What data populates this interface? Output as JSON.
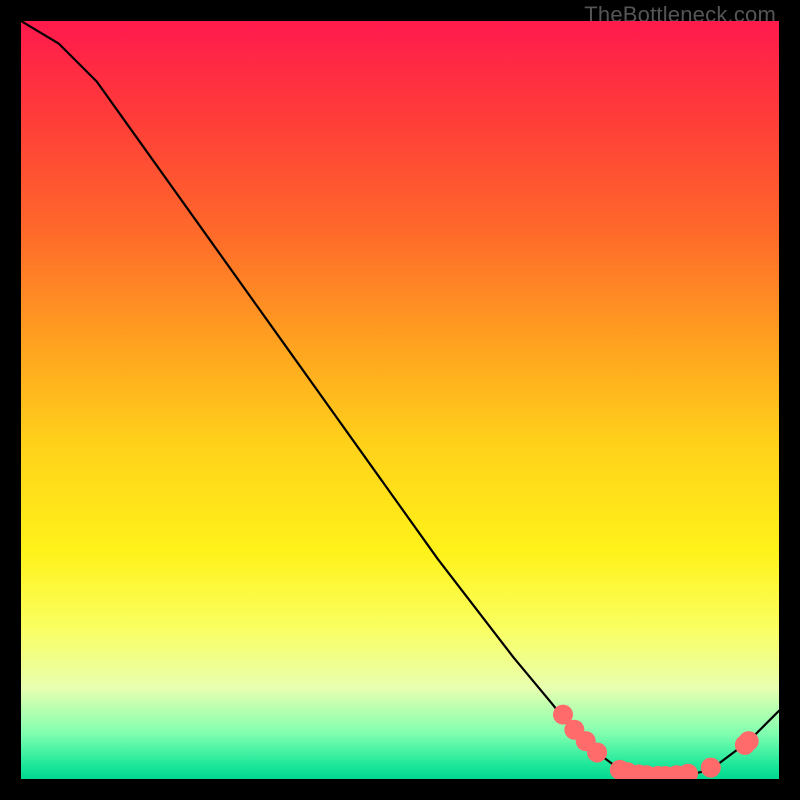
{
  "watermark": "TheBottleneck.com",
  "chart_data": {
    "type": "line",
    "title": "",
    "xlabel": "",
    "ylabel": "",
    "xlim": [
      0,
      100
    ],
    "ylim": [
      0,
      100
    ],
    "grid": false,
    "series": [
      {
        "name": "curve",
        "x": [
          0,
          5,
          10,
          15,
          20,
          25,
          30,
          35,
          40,
          45,
          50,
          55,
          60,
          65,
          70,
          74,
          76,
          78,
          80,
          82,
          84,
          86,
          88,
          90,
          92,
          94,
          96,
          98,
          100
        ],
        "values": [
          100,
          97,
          92,
          85,
          78,
          71,
          64,
          57,
          50,
          43,
          36,
          29,
          22.5,
          16,
          10,
          5,
          3.5,
          2,
          1,
          0.5,
          0.3,
          0.3,
          0.5,
          1,
          2,
          3.5,
          5,
          7,
          9
        ]
      }
    ],
    "markers": {
      "name": "highlight-points",
      "color": "#ff6a6a",
      "radius": 10,
      "points": [
        {
          "x": 71.5,
          "y": 8.5
        },
        {
          "x": 73.0,
          "y": 6.5
        },
        {
          "x": 74.5,
          "y": 5.0
        },
        {
          "x": 76.0,
          "y": 3.5
        },
        {
          "x": 79.0,
          "y": 1.2
        },
        {
          "x": 80.0,
          "y": 0.9
        },
        {
          "x": 81.5,
          "y": 0.6
        },
        {
          "x": 82.5,
          "y": 0.5
        },
        {
          "x": 84.0,
          "y": 0.4
        },
        {
          "x": 85.0,
          "y": 0.4
        },
        {
          "x": 86.5,
          "y": 0.5
        },
        {
          "x": 88.0,
          "y": 0.7
        },
        {
          "x": 91.0,
          "y": 1.5
        },
        {
          "x": 95.5,
          "y": 4.5
        },
        {
          "x": 96.0,
          "y": 5.0
        }
      ]
    }
  }
}
